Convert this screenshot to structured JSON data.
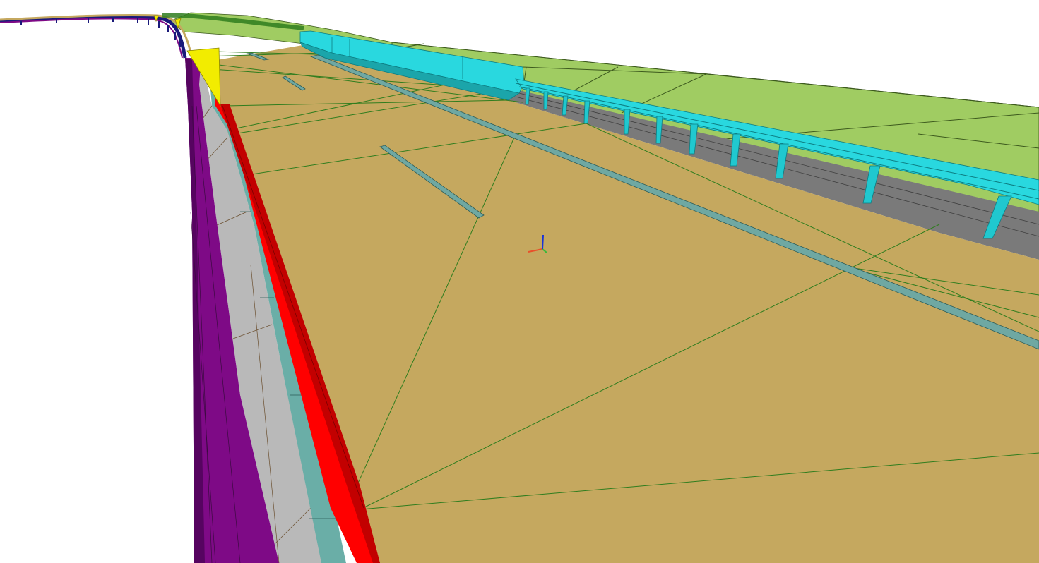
{
  "viewport": {
    "background": "#ffffff",
    "render_mode": "shaded-with-edges"
  },
  "colors": {
    "pavement": "#c5a85f",
    "pavement_edge": "#2f7d1e",
    "terrain": "#a0cc62",
    "terrain_edge": "#3d5a1e",
    "barrier": "#29d8df",
    "barrier_dark": "#1ba5aa",
    "guardrail_post": "#20c8cf",
    "shoulder_gray": "#7a7a7a",
    "curb_red": "#ff0000",
    "curb_red_dark": "#c20000",
    "gutter_teal": "#6aaea7",
    "sidewalk_gray": "#b9b9b9",
    "slope_purple": "#7e0a86",
    "slope_purple_dark": "#560460",
    "marker_yellow": "#f2ec00",
    "drainage_strip": "#6fa8a2",
    "axis_x": "#e8502a",
    "axis_y": "#38b83a",
    "axis_z": "#1832d8"
  },
  "objects": [
    {
      "name": "road-pavement",
      "layer": "surface"
    },
    {
      "name": "terrain-embankment",
      "layer": "terrain"
    },
    {
      "name": "concrete-barrier",
      "layer": "barrier"
    },
    {
      "name": "guardrail",
      "layer": "barrier"
    },
    {
      "name": "gravel-shoulder",
      "layer": "shoulder"
    },
    {
      "name": "curb",
      "layer": "curb"
    },
    {
      "name": "gutter",
      "layer": "drainage"
    },
    {
      "name": "sidewalk",
      "layer": "sidewalk"
    },
    {
      "name": "fill-slope",
      "layer": "slope"
    },
    {
      "name": "station-marker",
      "layer": "markers"
    },
    {
      "name": "drainage-strip",
      "layer": "drainage"
    }
  ],
  "axis_gizmo": {
    "axes": [
      "x",
      "y",
      "z"
    ]
  }
}
